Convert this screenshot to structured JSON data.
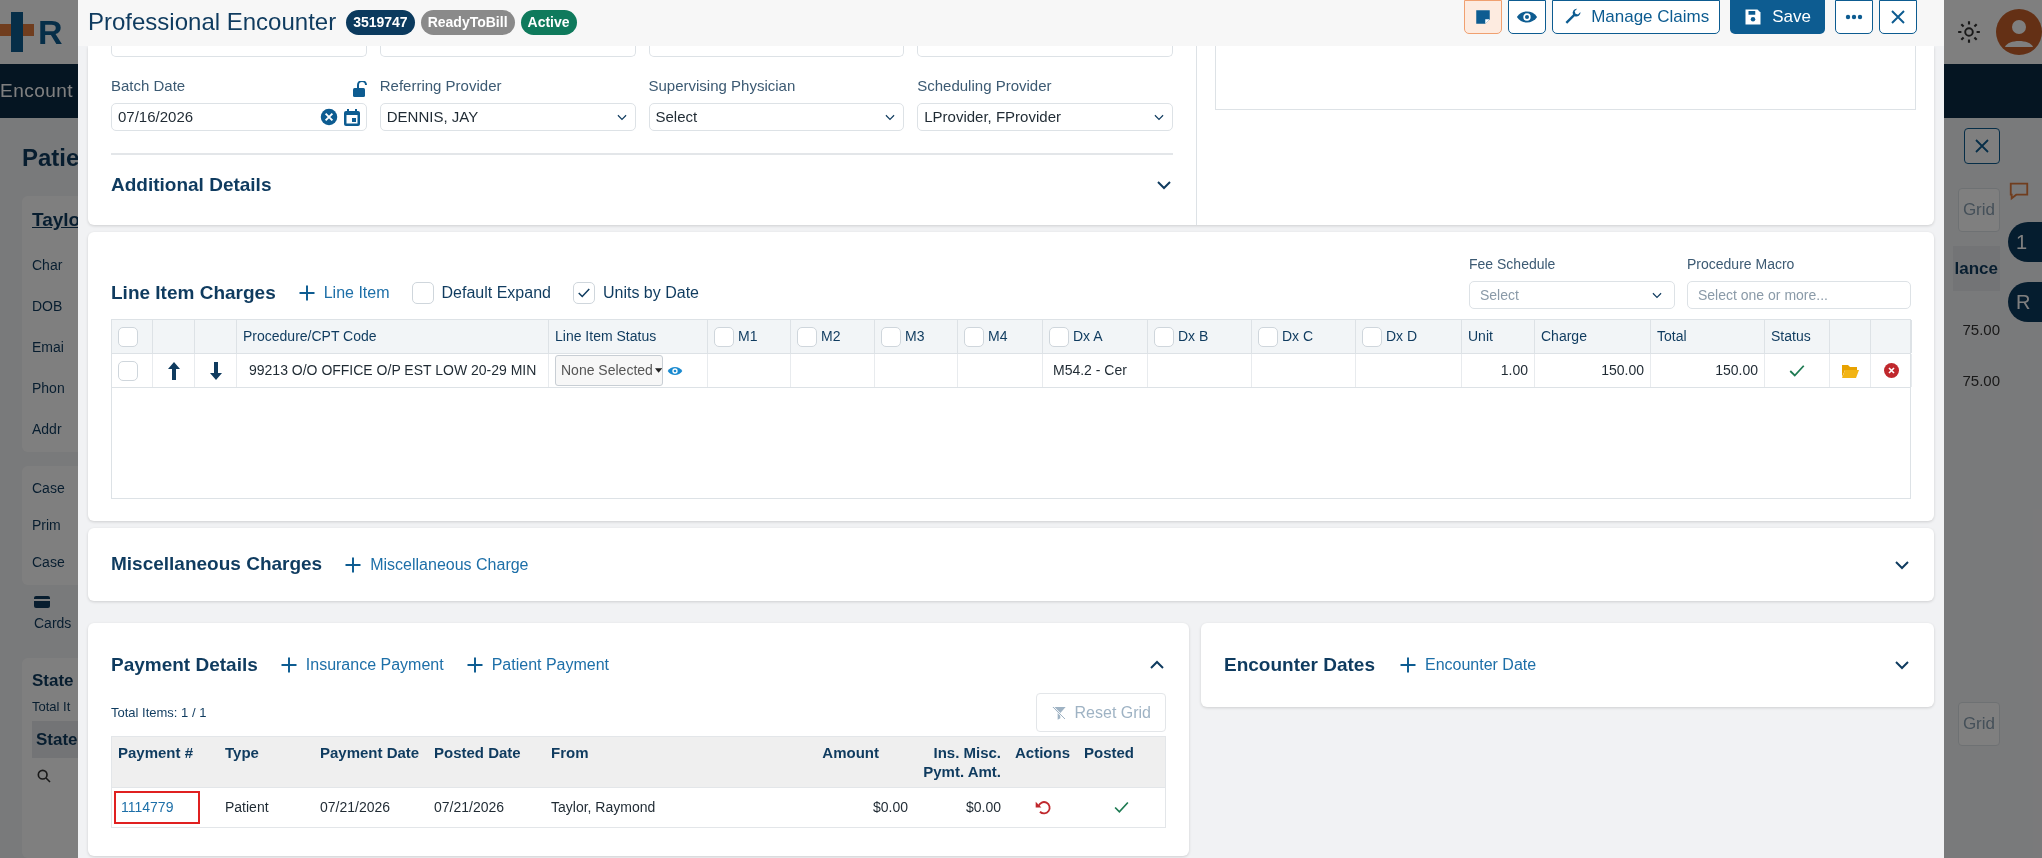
{
  "background": {
    "logo_letter": "R",
    "nav_label": "Encount",
    "heading": "Patie",
    "patient_link": "Taylo",
    "fields": [
      "Char",
      "DOB",
      "Emai",
      "Phon",
      "Addr"
    ],
    "case_fields": [
      "Case",
      "Prim",
      "Case"
    ],
    "cards_label": "Cards",
    "statements_title": "State",
    "total_items": "Total It",
    "column_header": "State",
    "right_reset": "Grid",
    "right_column_header": "lance",
    "right_values": [
      "75.00",
      "75.00"
    ],
    "right_reset_lower": "Grid",
    "badges": [
      "1",
      "R"
    ]
  },
  "modal": {
    "title": "Professional Encounter",
    "badges": [
      {
        "text": "3519747",
        "color": "#0b3a5e"
      },
      {
        "text": "ReadyToBill",
        "color": "#8a8a8a"
      },
      {
        "text": "Active",
        "color": "#0f7a5c"
      }
    ],
    "toolbar": [
      {
        "kind": "note"
      },
      {
        "kind": "view"
      },
      {
        "kind": "manage",
        "label": "Manage Claims"
      },
      {
        "kind": "save",
        "label": "Save"
      },
      {
        "kind": "more"
      },
      {
        "kind": "close"
      }
    ]
  },
  "encounter_form": {
    "fields": [
      {
        "kind": "date",
        "label": "Batch Date",
        "value": "07/16/2026"
      },
      {
        "kind": "select",
        "label": "Referring Provider",
        "value": "DENNIS, JAY"
      },
      {
        "kind": "select",
        "label": "Supervising Physician",
        "value": "Select"
      },
      {
        "kind": "select",
        "label": "Scheduling Provider",
        "value": "LProvider, FProvider"
      }
    ],
    "additional_details": {
      "title": "Additional Details",
      "expanded": false
    }
  },
  "line_items": {
    "title": "Line Item Charges",
    "add_label": "Line Item",
    "options": [
      {
        "label": "Default Expand",
        "checked": false
      },
      {
        "label": "Units by Date",
        "checked": true
      }
    ],
    "fee_schedule": {
      "label": "Fee Schedule",
      "placeholder": "Select"
    },
    "procedure_macro": {
      "label": "Procedure Macro",
      "placeholder": "Select one or more..."
    },
    "columns": [
      {
        "kind": "select",
        "checked": false
      },
      {
        "kind": "up"
      },
      {
        "kind": "down"
      },
      {
        "kind": "procedure",
        "label": "Procedure/CPT Code"
      },
      {
        "kind": "line_status",
        "label": "Line Item Status"
      },
      {
        "kind": "modifier",
        "label": "M1",
        "checked": false
      },
      {
        "kind": "modifier",
        "label": "M2",
        "checked": false
      },
      {
        "kind": "modifier",
        "label": "M3",
        "checked": false
      },
      {
        "kind": "modifier",
        "label": "M4",
        "checked": false
      },
      {
        "kind": "dx",
        "label": "Dx A",
        "checked": false
      },
      {
        "kind": "dx",
        "label": "Dx B",
        "checked": false
      },
      {
        "kind": "dx",
        "label": "Dx C",
        "checked": false
      },
      {
        "kind": "dx",
        "label": "Dx D",
        "checked": false
      },
      {
        "kind": "unit",
        "label": "Unit"
      },
      {
        "kind": "charge",
        "label": "Charge"
      },
      {
        "kind": "total",
        "label": "Total"
      },
      {
        "kind": "status",
        "label": "Status"
      },
      {
        "kind": "attach"
      },
      {
        "kind": "delete"
      }
    ],
    "rows": [
      {
        "checked": false,
        "procedure": "99213 O/O OFFICE O/P EST LOW 20-29 MIN",
        "line_status": "None Selected",
        "dx": [
          "M54.2 - Cer"
        ],
        "unit": "1.00",
        "charge": "150.00",
        "total": "150.00",
        "valid": true
      }
    ]
  },
  "misc_charges": {
    "title": "Miscellaneous Charges",
    "add_label": "Miscellaneous Charge",
    "expanded": false
  },
  "payment_details": {
    "title": "Payment Details",
    "actions": [
      "Insurance Payment",
      "Patient Payment"
    ],
    "expanded": true,
    "total_items": "Total Items: 1 / 1",
    "reset_grid": {
      "label": "Reset Grid",
      "disabled": true
    },
    "columns": [
      "Payment #",
      "Type",
      "Payment Date",
      "Posted Date",
      "From",
      "Amount",
      "Ins. Misc. Pymt. Amt.",
      "Actions",
      "Posted"
    ],
    "rows": [
      {
        "selected": true,
        "payment_no": "1114779",
        "type": "Patient",
        "payment_date": "07/21/2026",
        "posted_date": "07/21/2026",
        "from": "Taylor, Raymond",
        "amount": "$0.00",
        "ins_misc": "$0.00",
        "posted": true
      }
    ]
  },
  "encounter_dates": {
    "title": "Encounter Dates",
    "add_label": "Encounter Date",
    "expanded": false
  }
}
